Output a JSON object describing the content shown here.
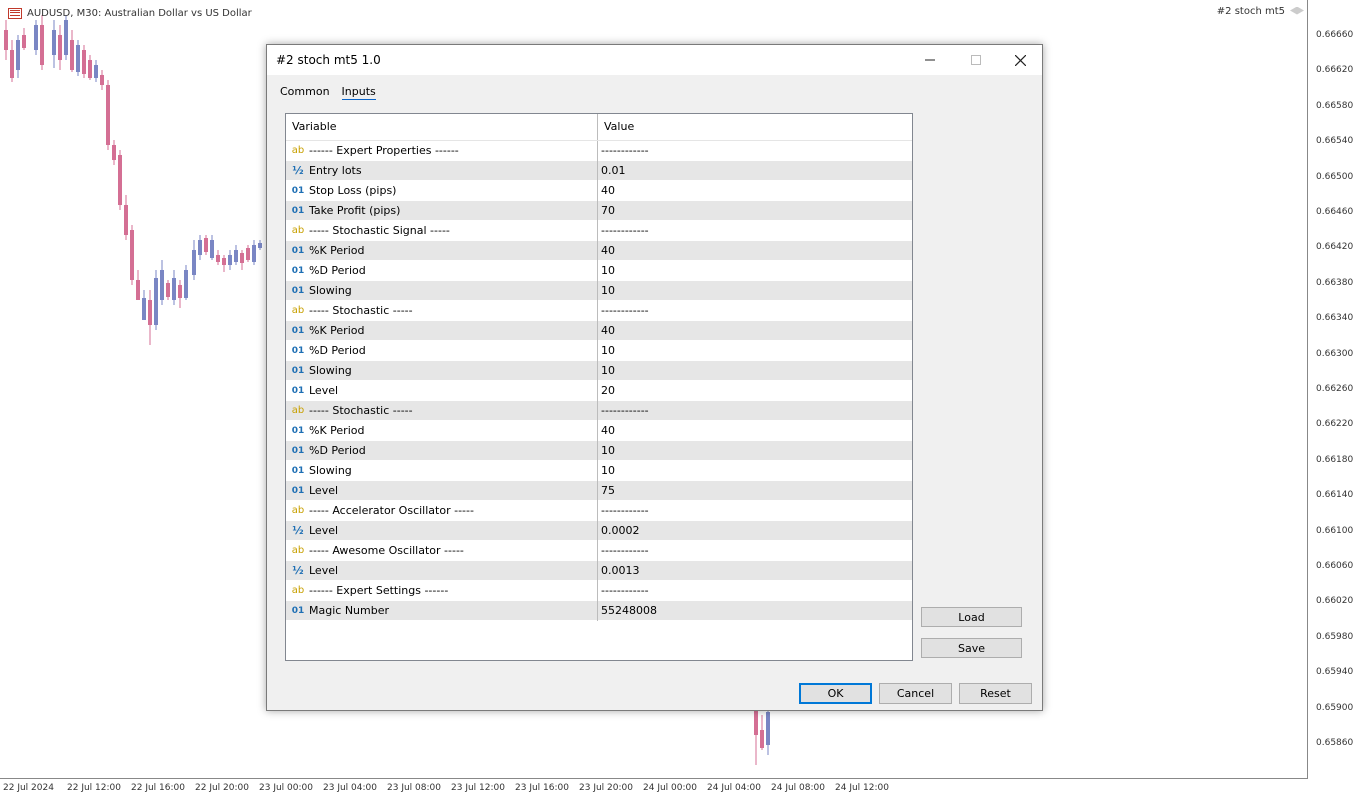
{
  "chart": {
    "symbol_title": "AUDUSD, M30:  Australian Dollar vs US Dollar",
    "ea_label": "#2 stoch mt5",
    "price_ticks": [
      "0.66660",
      "0.66620",
      "0.66580",
      "0.66540",
      "0.66500",
      "0.66460",
      "0.66420",
      "0.66380",
      "0.66340",
      "0.66300",
      "0.66260",
      "0.66220",
      "0.66180",
      "0.66140",
      "0.66100",
      "0.66060",
      "0.66020",
      "0.65980",
      "0.65940",
      "0.65900",
      "0.65860"
    ],
    "time_ticks": [
      "22 Jul 2024",
      "22 Jul 12:00",
      "22 Jul 16:00",
      "22 Jul 20:00",
      "23 Jul 00:00",
      "23 Jul 04:00",
      "23 Jul 08:00",
      "23 Jul 12:00",
      "23 Jul 16:00",
      "23 Jul 20:00",
      "24 Jul 00:00",
      "24 Jul 04:00",
      "24 Jul 08:00",
      "24 Jul 12:00"
    ],
    "colors": {
      "bull": "#7a86c4",
      "bear": "#d46f94"
    }
  },
  "dialog": {
    "title": "#2 stoch mt5 1.0",
    "tabs": [
      "Common",
      "Inputs"
    ],
    "active_tab": "Inputs",
    "columns": {
      "variable": "Variable",
      "value": "Value"
    },
    "rows": [
      {
        "type": "ab",
        "name": "------ Expert Properties ------",
        "value": "------------"
      },
      {
        "type": "half",
        "name": "Entry lots",
        "value": "0.01"
      },
      {
        "type": "01",
        "name": "Stop Loss (pips)",
        "value": "40"
      },
      {
        "type": "01",
        "name": "Take Profit (pips)",
        "value": "70"
      },
      {
        "type": "ab",
        "name": "----- Stochastic Signal -----",
        "value": "------------"
      },
      {
        "type": "01",
        "name": "%K Period",
        "value": "40"
      },
      {
        "type": "01",
        "name": "%D Period",
        "value": "10"
      },
      {
        "type": "01",
        "name": "Slowing",
        "value": "10"
      },
      {
        "type": "ab",
        "name": "----- Stochastic -----",
        "value": "------------"
      },
      {
        "type": "01",
        "name": "%K Period",
        "value": "40"
      },
      {
        "type": "01",
        "name": "%D Period",
        "value": "10"
      },
      {
        "type": "01",
        "name": "Slowing",
        "value": "10"
      },
      {
        "type": "01",
        "name": "Level",
        "value": "20"
      },
      {
        "type": "ab",
        "name": "----- Stochastic -----",
        "value": "------------"
      },
      {
        "type": "01",
        "name": "%K Period",
        "value": "40"
      },
      {
        "type": "01",
        "name": "%D Period",
        "value": "10"
      },
      {
        "type": "01",
        "name": "Slowing",
        "value": "10"
      },
      {
        "type": "01",
        "name": "Level",
        "value": "75"
      },
      {
        "type": "ab",
        "name": "----- Accelerator Oscillator -----",
        "value": "------------"
      },
      {
        "type": "half",
        "name": "Level",
        "value": "0.0002"
      },
      {
        "type": "ab",
        "name": "----- Awesome Oscillator -----",
        "value": "------------"
      },
      {
        "type": "half",
        "name": "Level",
        "value": "0.0013"
      },
      {
        "type": "ab",
        "name": "------ Expert Settings ------",
        "value": "------------"
      },
      {
        "type": "01",
        "name": "Magic Number",
        "value": "55248008"
      }
    ],
    "buttons": {
      "load": "Load",
      "save": "Save",
      "ok": "OK",
      "cancel": "Cancel",
      "reset": "Reset"
    },
    "type_glyphs": {
      "ab": "ab",
      "01": "01",
      "half": "½"
    }
  }
}
